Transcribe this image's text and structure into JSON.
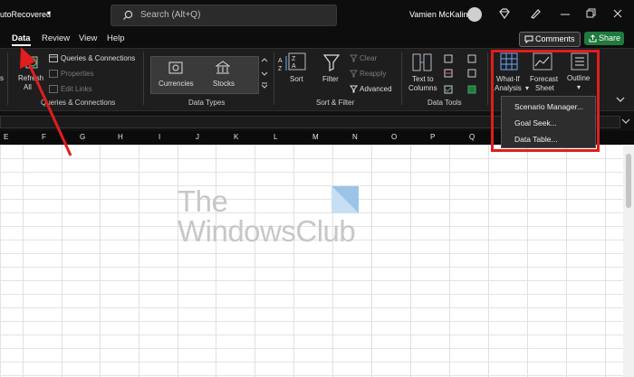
{
  "titlebar": {
    "doc_title": "utoRecovered",
    "search_placeholder": "Search (Alt+Q)",
    "user_name": "Vamien McKalin"
  },
  "tabs": [
    {
      "label": "Data",
      "active": true
    },
    {
      "label": "Review"
    },
    {
      "label": "View"
    },
    {
      "label": "Help"
    }
  ],
  "actions": {
    "comments": "Comments",
    "share": "Share"
  },
  "ribbon": {
    "queries": {
      "refresh_line1": "Refresh",
      "refresh_line2": "All",
      "items": [
        "Queries & Connections",
        "Properties",
        "Edit Links"
      ],
      "group_label": "Queries & Connections"
    },
    "data_types": {
      "items": [
        "Currencies",
        "Stocks"
      ],
      "group_label": "Data Types"
    },
    "sort_filter": {
      "sort": "Sort",
      "filter": "Filter",
      "clear": "Clear",
      "reapply": "Reapply",
      "advanced": "Advanced",
      "group_label": "Sort & Filter"
    },
    "data_tools": {
      "text_to_columns_line1": "Text to",
      "text_to_columns_line2": "Columns",
      "group_label": "Data Tools"
    },
    "forecast": {
      "whatif_line1": "What-If",
      "whatif_line2": "Analysis",
      "forecast_line1": "Forecast",
      "forecast_line2": "Sheet",
      "outline": "Outline"
    }
  },
  "columns": [
    "E",
    "F",
    "G",
    "H",
    "I",
    "J",
    "K",
    "L",
    "M",
    "N",
    "O",
    "P",
    "Q"
  ],
  "watermark": {
    "line1": "The",
    "line2": "WindowsClub"
  },
  "whatif_menu": [
    "Scenario Manager...",
    "Goal Seek...",
    "Data Table..."
  ],
  "colors": {
    "highlight": "#e11d1d",
    "share_button": "#1f7a3d",
    "ribbon_bg": "#1e1e1e"
  }
}
